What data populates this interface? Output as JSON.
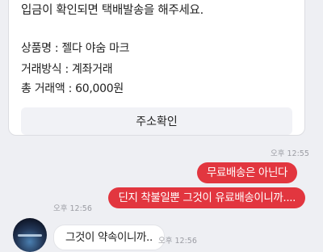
{
  "order_card": {
    "notice": "입금이 확인되면 택배발송을 해주세요.",
    "product": "상품명 : 젤다 야숨 마크",
    "method": "거래방식 : 계좌거래",
    "total": "총 거래액 : 60,000원",
    "address_button": "주소확인"
  },
  "timestamps": {
    "card": "오후 12:55",
    "sent": "오후 12:56",
    "received": "오후 12:56"
  },
  "messages": {
    "sent_1": "무료배송은 아닌다",
    "sent_2": "딘지 착불일뿐 그것이 유료배송이니까....",
    "received_1": "그것이 약속이니까.."
  }
}
